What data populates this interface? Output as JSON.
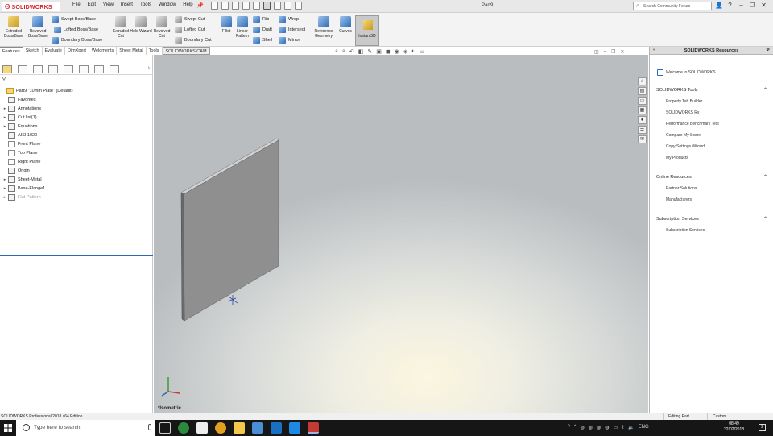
{
  "app": {
    "logo_text": "SOLIDWORKS",
    "menu": [
      "File",
      "Edit",
      "View",
      "Insert",
      "Tools",
      "Window",
      "Help"
    ],
    "document_title": "Part9",
    "search_placeholder": "Search Community Forum"
  },
  "ribbon": {
    "big_buttons": [
      {
        "label": "Extruded Boss/Base",
        "icon": "extrude-boss-icon"
      },
      {
        "label": "Revolved Boss/Base",
        "icon": "revolve-boss-icon"
      },
      {
        "label": "Extruded Cut",
        "icon": "extrude-cut-icon"
      },
      {
        "label": "Hole Wizard",
        "icon": "hole-wizard-icon"
      },
      {
        "label": "Revolved Cut",
        "icon": "revolve-cut-icon"
      },
      {
        "label": "Fillet",
        "icon": "fillet-icon"
      },
      {
        "label": "Linear Pattern",
        "icon": "linear-pattern-icon"
      },
      {
        "label": "Reference Geometry",
        "icon": "reference-geometry-icon"
      },
      {
        "label": "Curves",
        "icon": "curves-icon"
      }
    ],
    "small_buttons": [
      {
        "label": "Swept Boss/Base"
      },
      {
        "label": "Lofted Boss/Base"
      },
      {
        "label": "Boundary Boss/Base"
      },
      {
        "label": "Swept Cut"
      },
      {
        "label": "Lofted Cut"
      },
      {
        "label": "Boundary Cut"
      },
      {
        "label": "Rib"
      },
      {
        "label": "Draft"
      },
      {
        "label": "Shell"
      },
      {
        "label": "Wrap"
      },
      {
        "label": "Intersect"
      },
      {
        "label": "Mirror"
      }
    ],
    "instant3d_label": "Instant3D"
  },
  "tabs": [
    "Features",
    "Sketch",
    "Evaluate",
    "DimXpert",
    "Weldments",
    "Sheet Metal",
    "Tools",
    "SOLIDWORKS CAM"
  ],
  "feature_tree": {
    "items": [
      {
        "label": "Part9  \"10mm Plate\"  (Default)",
        "icon": "part-icon",
        "expand": "",
        "level": 0
      },
      {
        "label": "Favorites",
        "icon": "favorites-icon",
        "expand": "",
        "level": 1
      },
      {
        "label": "Annotations",
        "icon": "annotations-icon",
        "expand": "▸",
        "level": 1
      },
      {
        "label": "Cut list(1)",
        "icon": "cut-list-icon",
        "expand": "▸",
        "level": 1
      },
      {
        "label": "Equations",
        "icon": "equations-icon",
        "expand": "▸",
        "level": 1
      },
      {
        "label": "AISI 1020",
        "icon": "material-icon",
        "expand": "",
        "level": 1
      },
      {
        "label": "Front Plane",
        "icon": "plane-icon",
        "expand": "",
        "level": 1
      },
      {
        "label": "Top Plane",
        "icon": "plane-icon",
        "expand": "",
        "level": 1
      },
      {
        "label": "Right Plane",
        "icon": "plane-icon",
        "expand": "",
        "level": 1
      },
      {
        "label": "Origin",
        "icon": "origin-icon",
        "expand": "",
        "level": 1
      },
      {
        "label": "Sheet-Metal",
        "icon": "sheet-metal-icon",
        "expand": "▸",
        "level": 1
      },
      {
        "label": "Base-Flange1",
        "icon": "base-flange-icon",
        "expand": "▸",
        "level": 1
      },
      {
        "label": "Flat-Pattern",
        "icon": "flat-pattern-icon",
        "expand": "▸",
        "level": 1
      }
    ]
  },
  "graphics": {
    "view_label": "*Isometric"
  },
  "task_pane": {
    "title": "SOLIDWORKS Resources",
    "welcome": "Welcome to SOLIDWORKS",
    "sections": [
      {
        "title": "SOLIDWORKS Tools",
        "items": [
          "Property Tab Builder",
          "SOLIDWORKS Rx",
          "Performance Benchmark Test",
          "Compare My Score",
          "Copy Settings Wizard",
          "My Products"
        ]
      },
      {
        "title": "Online Resources",
        "items": [
          "Partner Solutions",
          "Manufacturers"
        ]
      },
      {
        "title": "Subscription Services",
        "items": [
          "Subscription Services"
        ]
      }
    ]
  },
  "status": {
    "edition": "SOLIDWORKS Professional 2018 x64 Edition",
    "mode": "Editing Part",
    "units": "Custom"
  },
  "taskbar": {
    "search_placeholder": "Type here to search",
    "time": "08:49",
    "date": "22/02/2018",
    "language": "ENG",
    "notifications": "2"
  },
  "colors": {
    "brand_red": "#d6202a",
    "plate_front": "#8f8f8f",
    "plate_top": "#d0d0d0",
    "plate_side": "#6a6a6a",
    "tree_accent": "#2d6ab6"
  }
}
